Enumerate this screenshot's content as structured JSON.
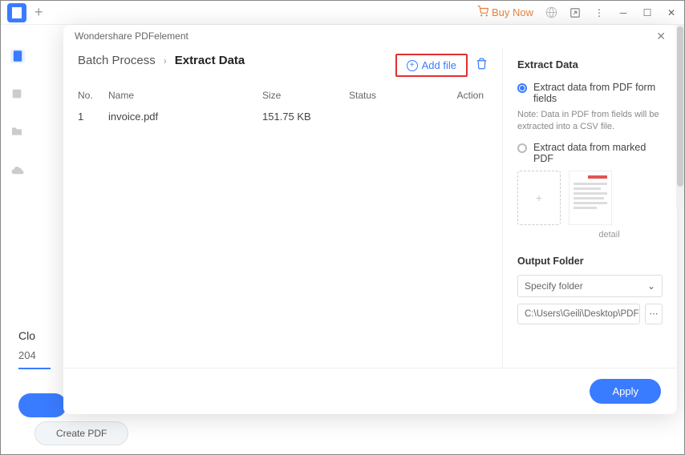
{
  "app": {
    "buyNow": "Buy Now"
  },
  "modal": {
    "title": "Wondershare PDFelement",
    "breadcrumb": {
      "parent": "Batch Process",
      "current": "Extract Data"
    },
    "addFileLabel": "Add file",
    "table": {
      "headers": {
        "no": "No.",
        "name": "Name",
        "size": "Size",
        "status": "Status",
        "action": "Action"
      },
      "rows": [
        {
          "no": "1",
          "name": "invoice.pdf",
          "size": "151.75 KB",
          "status": "",
          "action": ""
        }
      ]
    },
    "panel": {
      "title": "Extract Data",
      "option1": "Extract data from PDF form fields",
      "note": "Note: Data in PDF from fields will be extracted into a CSV file.",
      "option2": "Extract data from marked PDF",
      "detailLabel": "detail",
      "outputFolder": {
        "title": "Output Folder",
        "specify": "Specify folder",
        "path": "C:\\Users\\Geili\\Desktop\\PDFelement\\Da"
      }
    },
    "applyLabel": "Apply"
  },
  "behind": {
    "cloud": "Clo",
    "num": "204",
    "createPdf": "Create PDF"
  }
}
